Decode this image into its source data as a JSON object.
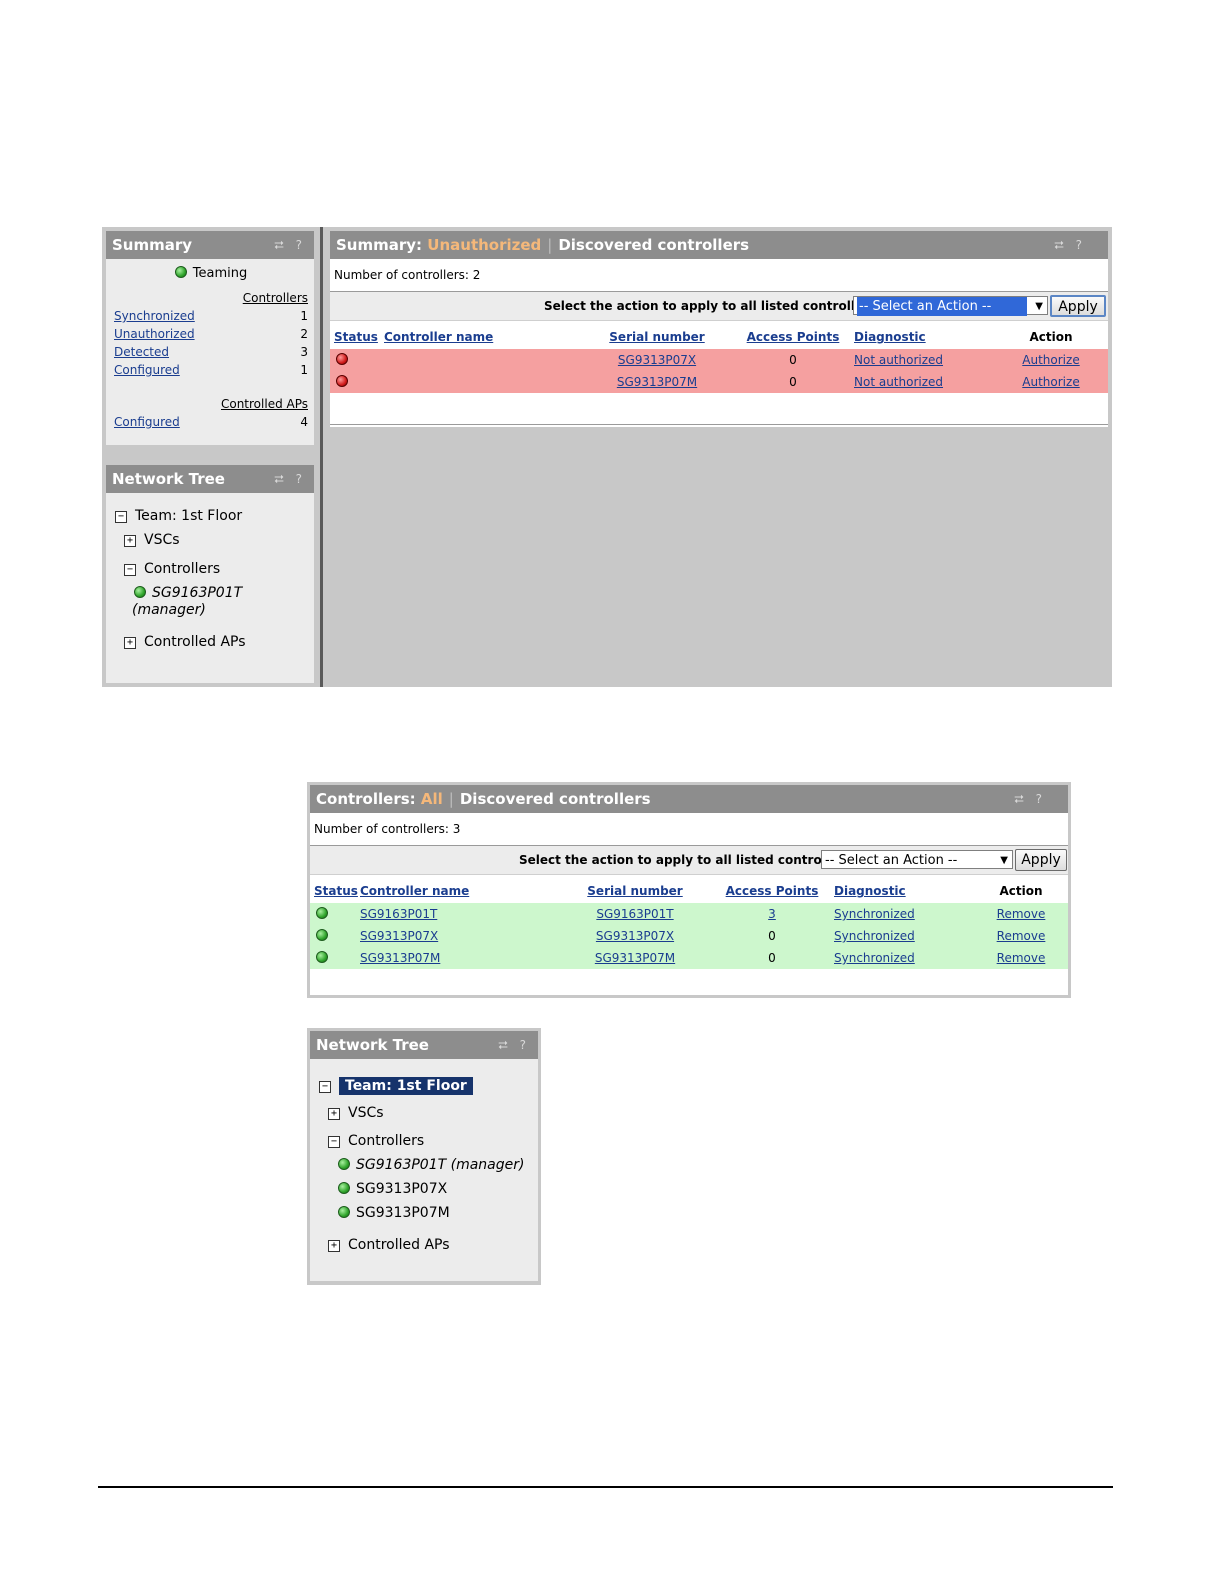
{
  "summary_panel": {
    "title": "Summary",
    "header_icons": "⮂ ?",
    "teaming_label": "Teaming",
    "controllers_heading": "Controllers",
    "controllers_rows": [
      {
        "label": "Synchronized",
        "value": "1"
      },
      {
        "label": "Unauthorized",
        "value": "2"
      },
      {
        "label": "Detected",
        "value": "3"
      },
      {
        "label": "Configured",
        "value": "1"
      }
    ],
    "aps_heading": "Controlled APs",
    "aps_rows": [
      {
        "label": "Configured",
        "value": "4"
      }
    ]
  },
  "network_tree_1": {
    "title": "Network Tree",
    "team": "Team: 1st Floor",
    "vscs": "VSCs",
    "controllers": "Controllers",
    "manager_name": "SG9163P01T",
    "manager_suffix": "(manager)",
    "controlled_aps": "Controlled APs"
  },
  "unauthorized_panel": {
    "title_prefix": "Summary:",
    "title_highlight": "Unauthorized",
    "title_separator": "|",
    "title_suffix": "Discovered controllers",
    "count_text": "Number of controllers: 2",
    "action_label": "Select the action to apply to all listed controllers:",
    "select_value": "-- Select an Action --",
    "apply_label": "Apply",
    "columns": [
      "Status",
      "Controller name",
      "Serial number",
      "Access Points",
      "Diagnostic",
      "Action"
    ],
    "rows": [
      {
        "status": "red",
        "name": "",
        "serial": "SG9313P07X",
        "aps": "0",
        "diagnostic": "Not authorized",
        "action": "Authorize"
      },
      {
        "status": "red",
        "name": "",
        "serial": "SG9313P07M",
        "aps": "0",
        "diagnostic": "Not authorized",
        "action": "Authorize"
      }
    ]
  },
  "all_panel": {
    "title_prefix": "Controllers:",
    "title_highlight": "All",
    "title_separator": "|",
    "title_suffix": "Discovered controllers",
    "count_text": "Number of controllers: 3",
    "action_label": "Select the action to apply to all listed controllers:",
    "select_value": "-- Select an Action --",
    "apply_label": "Apply",
    "columns": [
      "Status",
      "Controller name",
      "Serial number",
      "Access Points",
      "Diagnostic",
      "Action"
    ],
    "rows": [
      {
        "status": "green",
        "name": "SG9163P01T",
        "serial": "SG9163P01T",
        "aps": "3",
        "aps_link": true,
        "diagnostic": "Synchronized",
        "action": "Remove"
      },
      {
        "status": "green",
        "name": "SG9313P07X",
        "serial": "SG9313P07X",
        "aps": "0",
        "aps_link": false,
        "diagnostic": "Synchronized",
        "action": "Remove"
      },
      {
        "status": "green",
        "name": "SG9313P07M",
        "serial": "SG9313P07M",
        "aps": "0",
        "aps_link": false,
        "diagnostic": "Synchronized",
        "action": "Remove"
      }
    ]
  },
  "network_tree_2": {
    "title": "Network Tree",
    "team": "Team: 1st Floor",
    "vscs": "VSCs",
    "controllers": "Controllers",
    "controller_items": [
      "SG9163P01T (manager)",
      "SG9313P07X",
      "SG9313P07M"
    ],
    "controlled_aps": "Controlled APs"
  },
  "colors": {
    "panel_header": "#8d8d8d",
    "highlight": "#f5b87a",
    "unauthorized_row": "#f5a0a0",
    "synchronized_row": "#cdf7cd",
    "link": "#1a3d8f",
    "selected_node": "#16336b"
  }
}
